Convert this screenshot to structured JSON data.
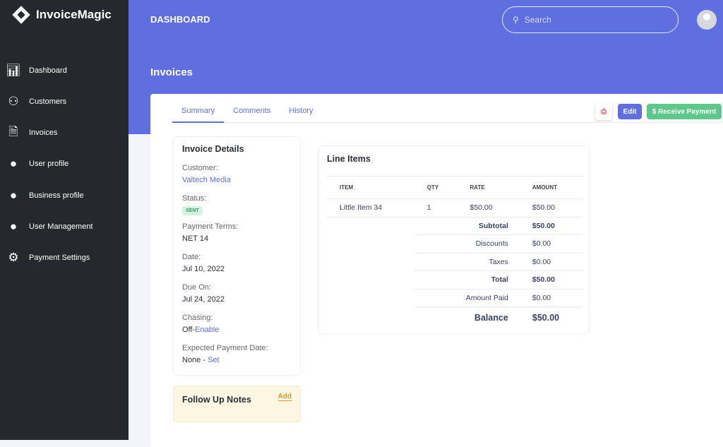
{
  "app": {
    "name": "InvoiceMagic"
  },
  "sidebar": {
    "items": [
      {
        "label": "Dashboard",
        "icon": "bar-chart-icon"
      },
      {
        "label": "Customers",
        "icon": "users-icon"
      },
      {
        "label": "Invoices",
        "icon": "invoice-icon"
      },
      {
        "label": "User profile",
        "icon": "user-circle-icon"
      },
      {
        "label": "Business profile",
        "icon": "user-circle-icon"
      },
      {
        "label": "User Management",
        "icon": "user-circle-icon"
      },
      {
        "label": "Payment Settings",
        "icon": "gear-icon"
      }
    ]
  },
  "header": {
    "title": "DASHBOARD",
    "search_placeholder": "Search",
    "page_title": "Invoices"
  },
  "tabs": [
    "Summary",
    "Comments",
    "History"
  ],
  "actions": {
    "edit": "Edit",
    "receive": "$ Receive Payment"
  },
  "details": {
    "title": "Invoice Details",
    "customer_label": "Customer:",
    "customer": "Valtech Media",
    "status_label": "Status:",
    "status": "SENT",
    "terms_label": "Payment Terms:",
    "terms": "NET 14",
    "date_label": "Date:",
    "date": "Jul 10, 2022",
    "due_label": "Due On:",
    "due": "Jul 24, 2022",
    "chasing_label": "Chasing:",
    "chasing": "Off",
    "chasing_link": "Enable",
    "expected_label": "Expected Payment Date:",
    "expected": "None - ",
    "expected_link": "Set"
  },
  "notes": {
    "title": "Follow Up Notes",
    "add": "Add"
  },
  "line_items": {
    "title": "Line Items",
    "headers": [
      "ITEM",
      "QTY",
      "RATE",
      "AMOUNT"
    ],
    "row": {
      "item": "Little Item 34",
      "qty": "1",
      "rate": "$50.00",
      "amount": "$50.00"
    },
    "totals": [
      {
        "label": "Subtotal",
        "value": "$50.00"
      },
      {
        "label": "Discounts",
        "value": "$0.00"
      },
      {
        "label": "Taxes",
        "value": "$0.00"
      },
      {
        "label": "Total",
        "value": "$50.00"
      },
      {
        "label": "Amount Paid",
        "value": "$0.00"
      }
    ],
    "balance_label": "Balance",
    "balance": "$50.00"
  },
  "colors": {
    "accent": "#5f6fdf",
    "success": "#5dc88a",
    "sidebar": "#24292b"
  }
}
